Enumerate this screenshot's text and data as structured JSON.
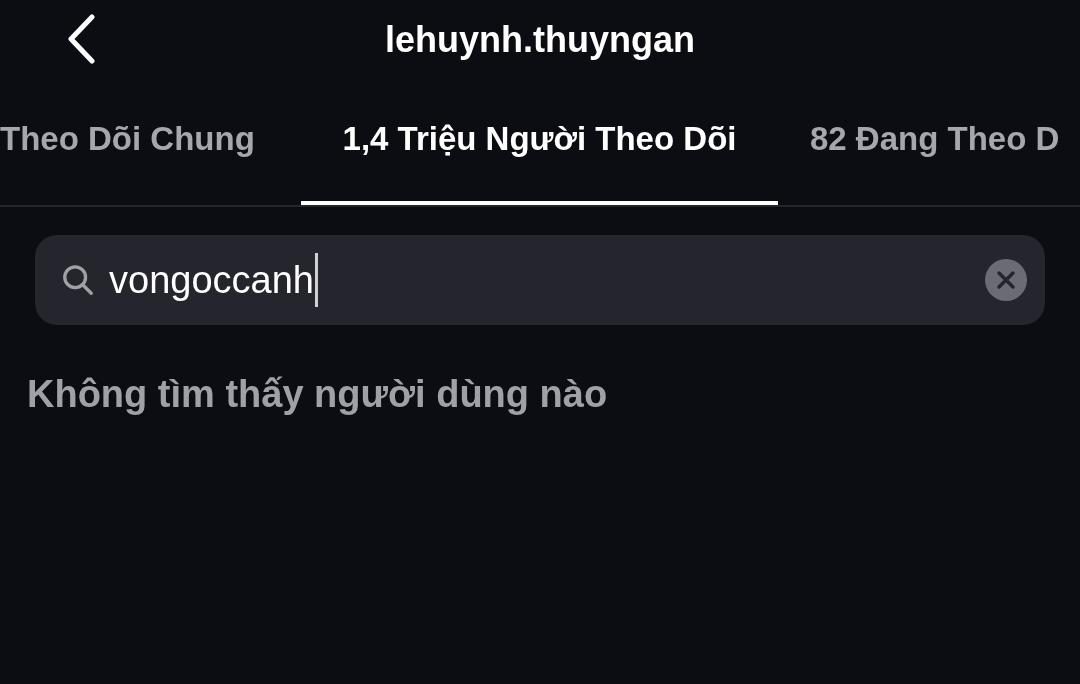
{
  "header": {
    "title": "lehuynh.thuyngan"
  },
  "tabs": [
    {
      "label": "Theo Dõi Chung",
      "selected": false
    },
    {
      "label": "1,4 Triệu Người Theo Dõi",
      "selected": true
    },
    {
      "label": "82 Đang Theo D",
      "selected": false
    }
  ],
  "search": {
    "value": "vongoccanh"
  },
  "message": "Không tìm thấy người dùng nào"
}
